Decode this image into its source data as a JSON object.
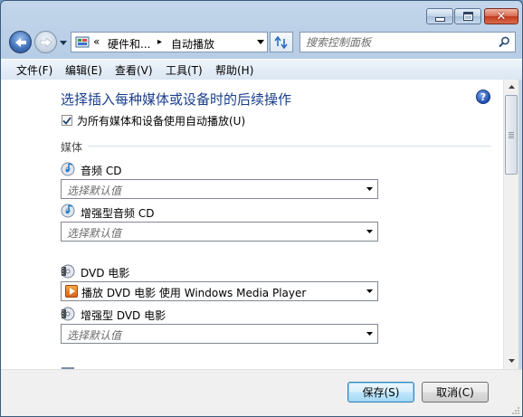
{
  "window": {
    "controls": {
      "minimize": "minimize",
      "maximize": "maximize",
      "close": "close"
    }
  },
  "address": {
    "chevron": "«",
    "crumb1": "硬件和...",
    "arrow": "▸",
    "crumb2": "自动播放"
  },
  "search": {
    "placeholder": "搜索控制面板"
  },
  "menu": [
    "文件(F)",
    "编辑(E)",
    "查看(V)",
    "工具(T)",
    "帮助(H)"
  ],
  "main": {
    "heading": "选择插入每种媒体或设备时的后续操作",
    "use_autoplay_label": "为所有媒体和设备使用自动播放(U)",
    "use_autoplay_checked": true,
    "section": "媒体",
    "items": [
      {
        "label": "音频 CD",
        "value": "选择默认值",
        "filled": false
      },
      {
        "label": "增强型音频 CD",
        "value": "选择默认值",
        "filled": false
      },
      {
        "label": "DVD 电影",
        "value": "播放 DVD 电影 使用 Windows Media Player",
        "filled": true
      },
      {
        "label": "增强型 DVD 电影",
        "value": "选择默认值",
        "filled": false
      }
    ]
  },
  "footer": {
    "save": "保存(S)",
    "cancel": "取消(C)"
  },
  "colors": {
    "heading": "#1a3e8c",
    "frame": "#b9cfe7",
    "close_button": "#c2391d"
  }
}
